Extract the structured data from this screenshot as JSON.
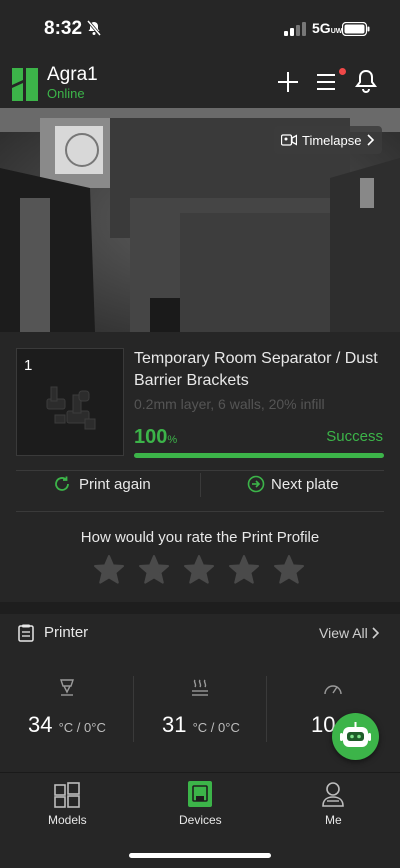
{
  "status_bar": {
    "time": "8:32",
    "network": "5G",
    "network_sub": "UW"
  },
  "header": {
    "device_name": "Agra1",
    "device_status": "Online"
  },
  "camera": {
    "timelapse_label": "Timelapse"
  },
  "job": {
    "plate_number": "1",
    "title": "Temporary Room Separator / Dust Barrier Brackets",
    "meta": "0.2mm layer, 6 walls, 20% infill",
    "progress_value": "100",
    "progress_unit": "%",
    "progress_fraction": 1.0,
    "status": "Success",
    "print_again_label": "Print again",
    "next_plate_label": "Next plate"
  },
  "rating": {
    "question": "How would you rate the Print Profile",
    "stars_total": 5,
    "stars_selected": 0
  },
  "printer": {
    "title": "Printer",
    "view_all_label": "View All",
    "nozzle": {
      "value": "34",
      "unit": "°C / 0°C"
    },
    "bed": {
      "value": "31",
      "unit": "°C / 0°C"
    },
    "speed": {
      "value": "10"
    }
  },
  "nav": {
    "models": "Models",
    "devices": "Devices",
    "me": "Me"
  },
  "colors": {
    "accent": "#3cb449",
    "background": "#262626",
    "alert": "#f04848"
  }
}
